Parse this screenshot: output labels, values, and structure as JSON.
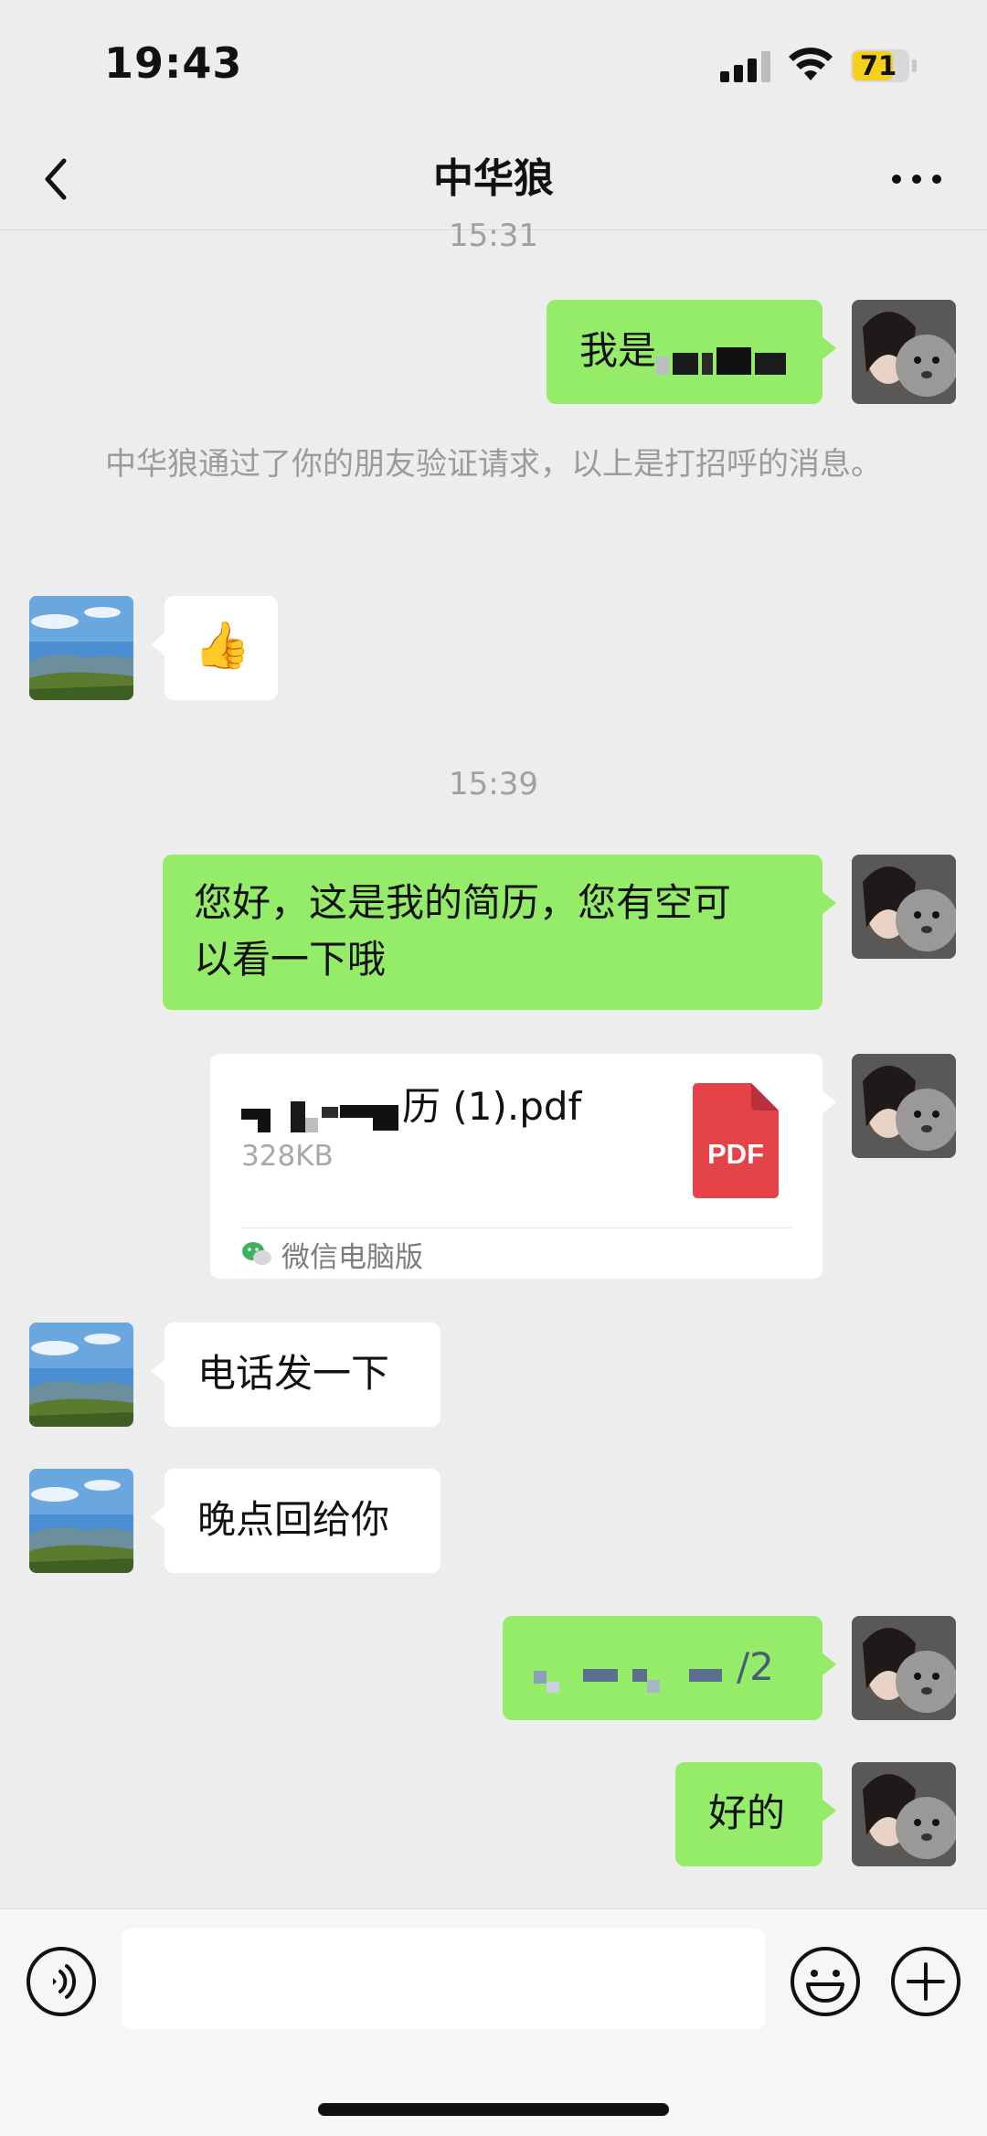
{
  "status_bar": {
    "time": "19:43",
    "battery": "71",
    "battery_color": "#f5d01a"
  },
  "nav": {
    "title": "中华狼",
    "back_icon": "chevron-left-icon",
    "more_icon": "ellipsis-icon"
  },
  "chat": {
    "timestamp_1": "15:31",
    "msg_intro_prefix": "我是",
    "system_notice": "中华狼通过了你的朋友验证请求，以上是打招呼的消息。",
    "thumbs_up_emoji": "👍",
    "timestamp_2": "15:39",
    "msg_resume_line1": "您好，这是我的简历，您有空可",
    "msg_resume_line2": "以看一下哦",
    "file": {
      "name_suffix": "历 (1).pdf",
      "size": "328KB",
      "type_label": "PDF",
      "source": "微信电脑版"
    },
    "msg_phone_request": "电话发一下",
    "msg_call_later": "晚点回给你",
    "msg_number_tail": "/2",
    "msg_ok": "好的"
  },
  "input_bar": {
    "placeholder": "",
    "voice_icon": "voice-icon",
    "emoji_icon": "emoji-icon",
    "plus_icon": "plus-icon"
  },
  "colors": {
    "outgoing_bubble": "#95ec69",
    "incoming_bubble": "#ffffff",
    "background": "#ededed",
    "pdf_red": "#e5434a"
  }
}
